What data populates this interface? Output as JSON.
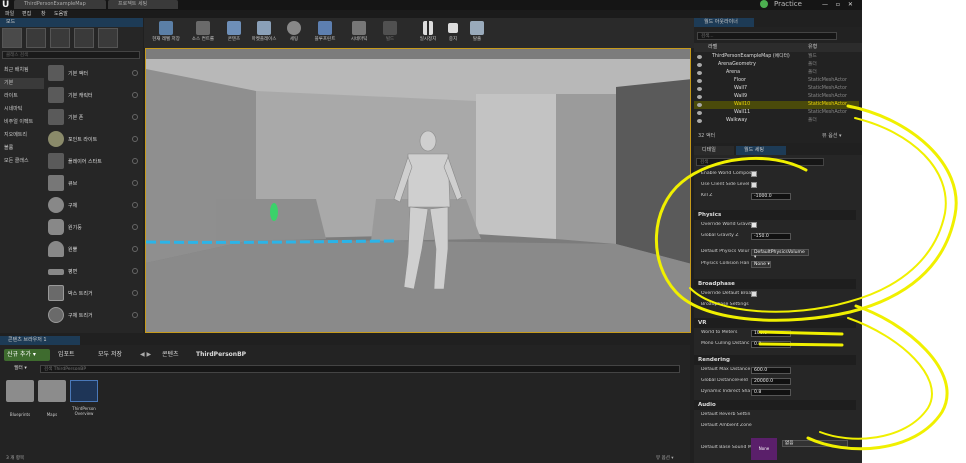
{
  "title_bar": {
    "tabs": [
      "ThirdPersonExampleMap",
      "프로젝트 세팅"
    ],
    "practice_label": "Practice",
    "window_controls": "— ▫ ✕"
  },
  "menu": [
    "파일",
    "편집",
    "창",
    "도움말"
  ],
  "modes": {
    "header": "모드",
    "search_placeholder": "클래스 검색",
    "categories": [
      "최근 배치됨",
      "기본",
      "라이트",
      "시네마틱",
      "비주얼 이펙트",
      "지오메트리",
      "볼륨",
      "모든 클래스"
    ],
    "selected_category": "기본",
    "items": [
      "기본 액터",
      "기본 캐릭터",
      "기본 폰",
      "포인트 라이트",
      "플레이어 스타트",
      "큐브",
      "구체",
      "원기둥",
      "원뿔",
      "평면",
      "박스 트리거",
      "구체 트리거"
    ]
  },
  "toolbar": {
    "buttons": [
      "현재 레벨 저장",
      "소스 컨트롤",
      "콘텐츠",
      "마켓플레이스",
      "세팅",
      "블루프린트",
      "시네마틱",
      "빌드",
      "일시정지",
      "중지",
      "탈출"
    ]
  },
  "content_browser": {
    "tab": "콘텐츠 브라우저 1",
    "new_button": "신규 추가 ▾",
    "import_button": "임포트",
    "save_all_button": "모두 저장",
    "path_root": "콘텐츠",
    "path_current": "ThirdPersonBP",
    "filter_label": "필터 ▾",
    "search_placeholder": "검색 ThirdPersonBP",
    "assets": [
      "Blueprints",
      "Maps",
      "ThirdPerson Overview"
    ],
    "item_count": "3 개 항목",
    "view_options": "뷰 옵션 ▾"
  },
  "outliner": {
    "tab": "월드 아웃라이너",
    "search_placeholder": "검색...",
    "col_label": "라벨",
    "col_type": "유형",
    "rows": [
      {
        "name": "ThirdPersonExampleMap (에디터)",
        "type": "월드",
        "indent": 8,
        "selected": false
      },
      {
        "name": "ArenaGeometry",
        "type": "폴더",
        "indent": 14,
        "selected": false
      },
      {
        "name": "Arena",
        "type": "폴더",
        "indent": 22,
        "selected": false
      },
      {
        "name": "Floor",
        "type": "StaticMeshActor",
        "indent": 30,
        "selected": false
      },
      {
        "name": "Wall7",
        "type": "StaticMeshActor",
        "indent": 30,
        "selected": false
      },
      {
        "name": "Wall9",
        "type": "StaticMeshActor",
        "indent": 30,
        "selected": false
      },
      {
        "name": "Wall10",
        "type": "StaticMeshActor",
        "indent": 30,
        "selected": true
      },
      {
        "name": "Wall11",
        "type": "StaticMeshActor",
        "indent": 30,
        "selected": false
      },
      {
        "name": "Walkway",
        "type": "폴더",
        "indent": 22,
        "selected": false
      }
    ],
    "actor_count": "32 액터",
    "view_options": "뷰 옵션 ▾"
  },
  "details": {
    "tab_details": "디테일",
    "tab_world": "월드 세팅",
    "search_placeholder": "검색",
    "props_top": [
      {
        "label": "Enable World Compos",
        "kind": "check",
        "checked": false
      },
      {
        "label": "Use Client Side Level",
        "kind": "check",
        "checked": false
      },
      {
        "label": "Kill Z",
        "kind": "value",
        "value": "-1000.0"
      }
    ],
    "physics_title": "Physics",
    "physics": [
      {
        "label": "Override World Gravit",
        "kind": "check",
        "checked": true
      },
      {
        "label": "Global Gravity Z",
        "kind": "value",
        "value": "-150.0"
      },
      {
        "label": "Default Physics Volur",
        "kind": "value",
        "value": "DefaultPhysicsVolume ▾"
      },
      {
        "label": "Physics Collision Han",
        "kind": "value",
        "value": "None ▾"
      }
    ],
    "broadphase_title": "Broadphase",
    "broadphase": [
      {
        "label": "Override Default Broa",
        "kind": "check",
        "checked": false
      },
      {
        "label": "Broadphase Settings",
        "kind": "text"
      }
    ],
    "vr_title": "VR",
    "vr": [
      {
        "label": "World to Meters",
        "kind": "value",
        "value": "100.0"
      },
      {
        "label": "Mono Culling Distanc",
        "kind": "value",
        "value": "0.0"
      }
    ],
    "rendering_title": "Rendering",
    "rendering": [
      {
        "label": "Default Max Distance",
        "kind": "value",
        "value": "600.0"
      },
      {
        "label": "Global DistanceField",
        "kind": "value",
        "value": "20000.0"
      },
      {
        "label": "Dynamic Indirect Sha",
        "kind": "value",
        "value": "0.8"
      }
    ],
    "audio_title": "Audio",
    "audio": [
      {
        "label": "Default Reverb Settin"
      },
      {
        "label": "Default Ambient Zone"
      }
    ],
    "base_sound_label": "Default Base Sound M",
    "base_sound_thumb": "None",
    "base_sound_value": "없음"
  },
  "annotation_color": "#f0f000"
}
